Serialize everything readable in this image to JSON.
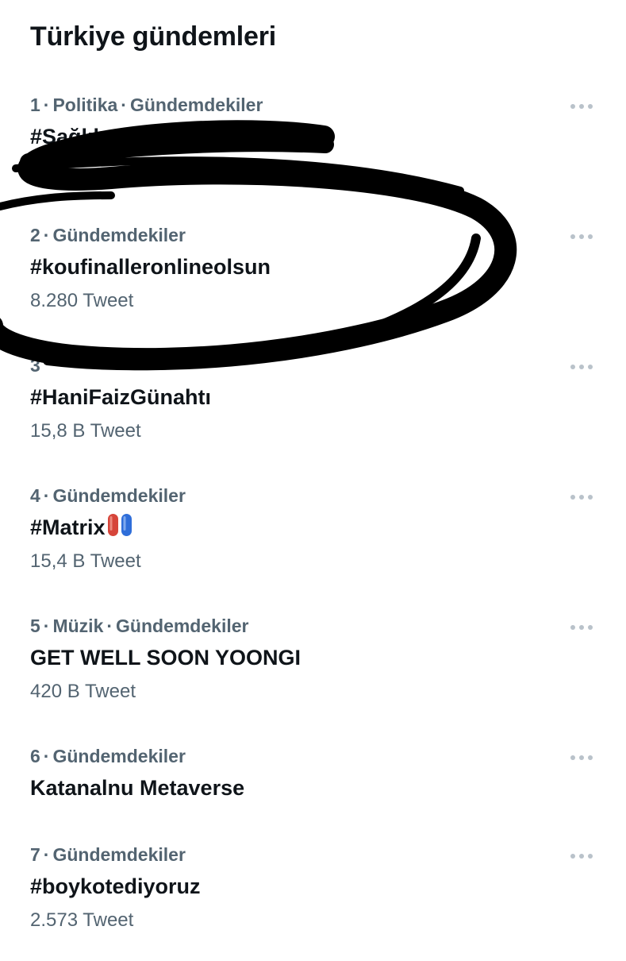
{
  "page": {
    "title": "Türkiye gündemleri"
  },
  "trends": [
    {
      "rank": "1",
      "category": "Politika",
      "context": "Gündemdekiler",
      "name": "#SağlıkçıTeşekkürEtmiyor",
      "count": ""
    },
    {
      "rank": "2",
      "category": "",
      "context": "Gündemdekiler",
      "name": "#koufinalleronlineolsun",
      "count": "8.280 Tweet"
    },
    {
      "rank": "3",
      "category": "",
      "context": "",
      "name": "#HaniFaizGünahtı",
      "count": "15,8 B Tweet"
    },
    {
      "rank": "4",
      "category": "",
      "context": "Gündemdekiler",
      "name": "#Matrix",
      "count": "15,4 B Tweet",
      "emoji": [
        "red-pill-icon",
        "blue-pill-icon"
      ]
    },
    {
      "rank": "5",
      "category": "Müzik",
      "context": "Gündemdekiler",
      "name": "GET WELL SOON YOONGI",
      "count": "420 B Tweet"
    },
    {
      "rank": "6",
      "category": "",
      "context": "Gündemdekiler",
      "name": "Katanalnu Metaverse",
      "count": ""
    },
    {
      "rank": "7",
      "category": "",
      "context": "Gündemdekiler",
      "name": "#boykotediyoruz",
      "count": "2.573 Tweet"
    }
  ],
  "icons": {
    "more": "more-horizontal-icon"
  },
  "colors": {
    "text_primary": "#0f1419",
    "text_secondary": "#536471",
    "icon_gray": "#b9c2ca",
    "scribble": "#000000",
    "red_pill": "#d6453a",
    "blue_pill": "#2f6ed9"
  }
}
